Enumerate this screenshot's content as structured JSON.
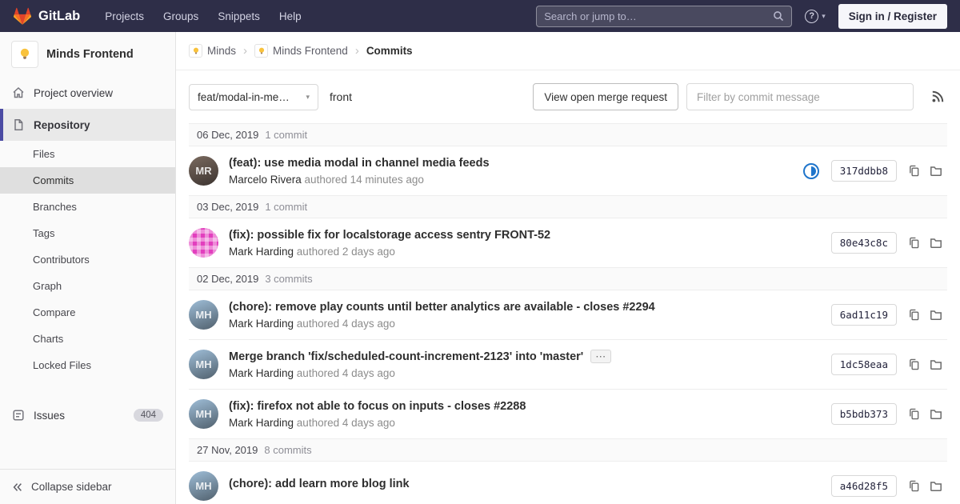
{
  "accent_color": "#4b4ba3",
  "navbar": {
    "brand": "GitLab",
    "links": [
      "Projects",
      "Groups",
      "Snippets",
      "Help"
    ],
    "search_placeholder": "Search or jump to…",
    "signin_label": "Sign in / Register"
  },
  "sidebar": {
    "project": {
      "name": "Minds Frontend",
      "avatar_icon": "lightbulb-icon"
    },
    "items": [
      {
        "label": "Project overview",
        "icon": "home-icon"
      },
      {
        "label": "Repository",
        "icon": "repository-icon",
        "active": true
      }
    ],
    "repo_subitems": [
      {
        "label": "Files"
      },
      {
        "label": "Commits",
        "active": true
      },
      {
        "label": "Branches"
      },
      {
        "label": "Tags"
      },
      {
        "label": "Contributors"
      },
      {
        "label": "Graph"
      },
      {
        "label": "Compare"
      },
      {
        "label": "Charts"
      },
      {
        "label": "Locked Files"
      }
    ],
    "issues": {
      "label": "Issues",
      "count": "404",
      "icon": "issues-icon"
    },
    "collapse_label": "Collapse sidebar"
  },
  "breadcrumb": [
    {
      "label": "Minds",
      "avatar_icon": "lightbulb-icon"
    },
    {
      "label": "Minds Frontend",
      "avatar_icon": "lightbulb-icon"
    },
    {
      "label": "Commits",
      "current": true
    }
  ],
  "controls": {
    "branch_dropdown": "feat/modal-in-me…",
    "ref_path": "front",
    "mr_button": "View open merge request",
    "filter_placeholder": "Filter by commit message"
  },
  "ci_color": "#1f75cb",
  "commit_groups": [
    {
      "date": "06 Dec, 2019",
      "count": "1 commit",
      "commits": [
        {
          "title": "(feat): use media modal in channel media feeds",
          "author": "Marcelo Rivera",
          "authored": "authored 14 minutes ago",
          "sha": "317ddbb8",
          "ci_status": "running",
          "avatar": {
            "type": "photo",
            "initials": "MR",
            "bg": "#3c3430",
            "bg2": "#7a6a5f"
          }
        }
      ]
    },
    {
      "date": "03 Dec, 2019",
      "count": "1 commit",
      "commits": [
        {
          "title": "(fix): possible fix for localstorage access sentry FRONT-52",
          "author": "Mark Harding",
          "authored": "authored 2 days ago",
          "sha": "80e43c8c",
          "avatar": {
            "type": "identicon",
            "initials": "",
            "bg": "#e23fbe"
          }
        }
      ]
    },
    {
      "date": "02 Dec, 2019",
      "count": "3 commits",
      "commits": [
        {
          "title": "(chore): remove play counts until better analytics are available - closes #2294",
          "author": "Mark Harding",
          "authored": "authored 4 days ago",
          "sha": "6ad11c19",
          "avatar": {
            "type": "photo",
            "initials": "MH",
            "bg": "#50606d",
            "bg2": "#9fbed8"
          }
        },
        {
          "title": "Merge branch 'fix/scheduled-count-increment-2123' into 'master'",
          "has_ellipsis": true,
          "author": "Mark Harding",
          "authored": "authored 4 days ago",
          "sha": "1dc58eaa",
          "avatar": {
            "type": "photo",
            "initials": "MH",
            "bg": "#50606d",
            "bg2": "#9fbed8"
          }
        },
        {
          "title": "(fix): firefox not able to focus on inputs - closes #2288",
          "author": "Mark Harding",
          "authored": "authored 4 days ago",
          "sha": "b5bdb373",
          "avatar": {
            "type": "photo",
            "initials": "MH",
            "bg": "#50606d",
            "bg2": "#9fbed8"
          }
        }
      ]
    },
    {
      "date": "27 Nov, 2019",
      "count": "8 commits",
      "commits": [
        {
          "title": "(chore): add learn more blog link",
          "author": "",
          "authored": "",
          "sha": "a46d28f5",
          "avatar": {
            "type": "photo",
            "initials": "MH",
            "bg": "#50606d",
            "bg2": "#9fbed8"
          }
        }
      ]
    }
  ]
}
